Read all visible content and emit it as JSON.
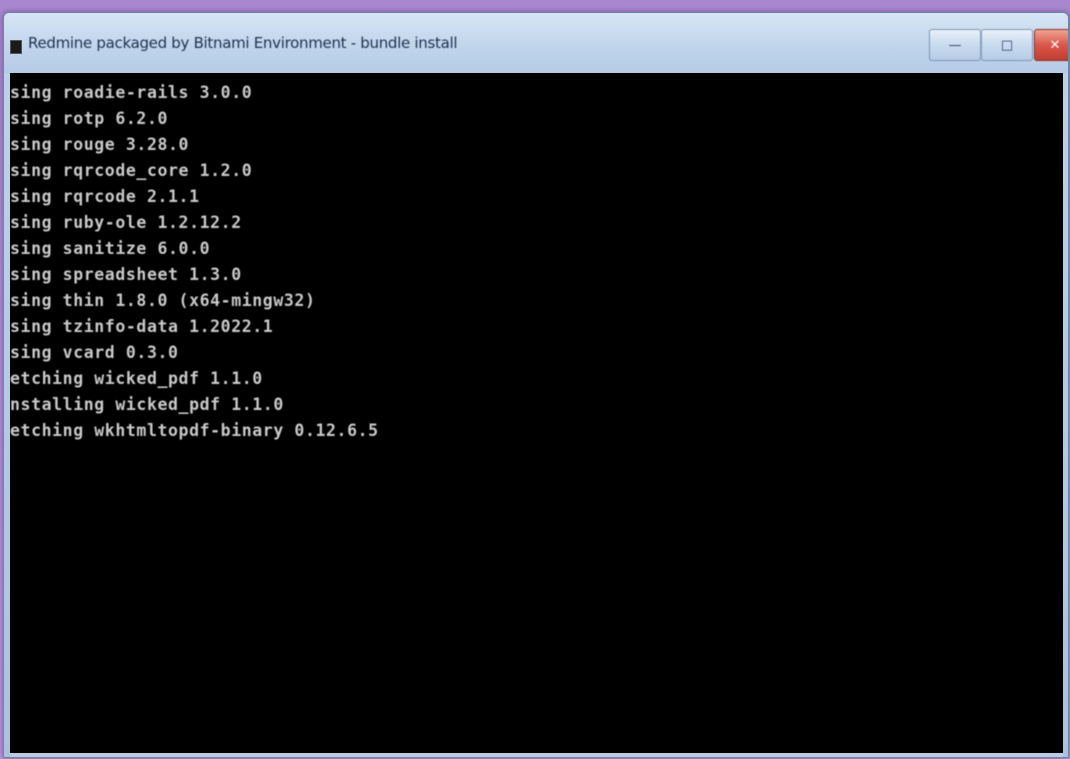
{
  "window": {
    "title": "Redmine packaged by Bitnami Environment - bundle install",
    "controls": {
      "minimize": "—",
      "maximize": "□",
      "close": "✕"
    }
  },
  "console": {
    "lines": [
      "sing roadie-rails 3.0.0",
      "sing rotp 6.2.0",
      "sing rouge 3.28.0",
      "sing rqrcode_core 1.2.0",
      "sing rqrcode 2.1.1",
      "sing ruby-ole 1.2.12.2",
      "sing sanitize 6.0.0",
      "sing spreadsheet 1.3.0",
      "sing thin 1.8.0 (x64-mingw32)",
      "sing tzinfo-data 1.2022.1",
      "sing vcard 0.3.0",
      "etching wicked_pdf 1.1.0",
      "nstalling wicked_pdf 1.1.0",
      "etching wkhtmltopdf-binary 0.12.6.5"
    ]
  }
}
